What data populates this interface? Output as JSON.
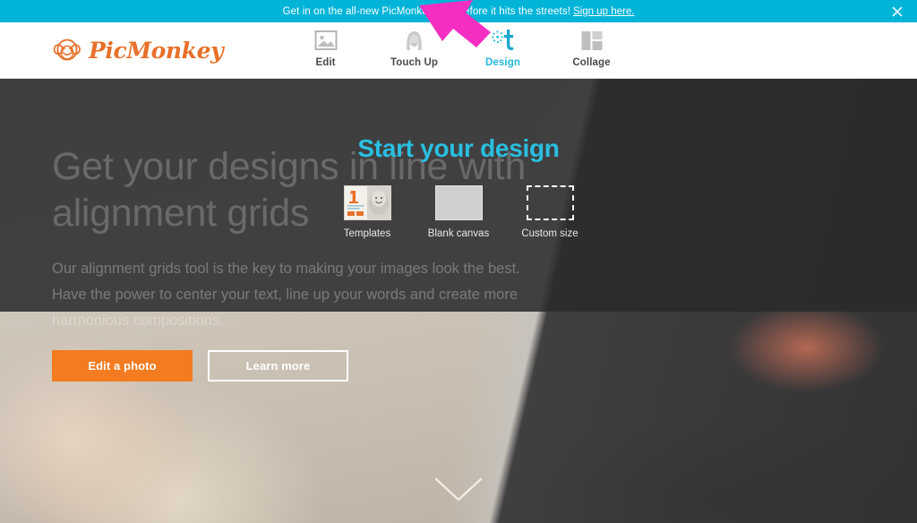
{
  "promo_banner": {
    "text": "Get in on the all-new PicMonkey Hub before it hits the streets!",
    "link_label": "Sign up here.",
    "close_icon": "close-icon",
    "background_color": "#00b4d8",
    "text_color": "#ffffff"
  },
  "navbar": {
    "logo": {
      "wordmark": "PicMonkey",
      "icon": "monkey-face-icon",
      "color": "#e8702a"
    },
    "items": [
      {
        "label": "Edit",
        "icon": "photo-icon",
        "active": false
      },
      {
        "label": "Touch Up",
        "icon": "face-icon",
        "active": false
      },
      {
        "label": "Design",
        "icon": "design-t-icon",
        "active": true
      },
      {
        "label": "Collage",
        "icon": "grid-icon",
        "active": false
      }
    ],
    "active_color": "#24b6d6",
    "label_color": "#4a4a4a"
  },
  "hero": {
    "background_heading": "Get your designs in line with alignment grids",
    "background_paragraph": "Our alignment grids tool is the key to making your images look the best. Have the power to center your text, line up your words and create more harmonious compositions.",
    "buttons": {
      "primary_label": "Edit a photo",
      "primary_color": "#f47b20",
      "secondary_label": "Learn more"
    },
    "scroll_indicator_icon": "chevron-down-icon"
  },
  "design_panel": {
    "title": "Start your design",
    "title_color": "#29bfe0",
    "options": [
      {
        "label": "Templates",
        "thumb": "template-card-thumb"
      },
      {
        "label": "Blank canvas",
        "thumb": "blank-canvas-thumb"
      },
      {
        "label": "Custom size",
        "thumb": "custom-size-dashed-thumb"
      }
    ]
  },
  "annotation": {
    "icon": "pink-arrow-annotation",
    "color": "#f52fc2",
    "points_to": "Design"
  }
}
